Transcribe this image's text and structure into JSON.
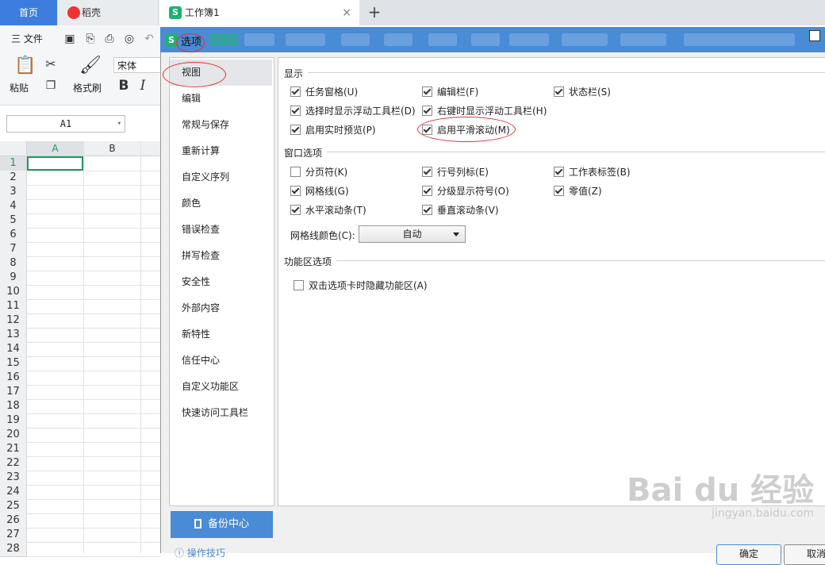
{
  "tabs": {
    "home": "首页",
    "daoke": "稻壳",
    "workbook": "工作簿1",
    "workbook_logo": "S",
    "close": "×",
    "add": "+"
  },
  "toolbar": {
    "file_menu": "三 文件",
    "paste_label": "粘贴",
    "format_painter_label": "格式刷",
    "font_name": "宋体",
    "bold": "B",
    "italic": "I"
  },
  "namebox": {
    "value": "A1"
  },
  "sheet": {
    "columns": [
      "A",
      "B"
    ],
    "rows": [
      "1",
      "2",
      "3",
      "4",
      "5",
      "6",
      "7",
      "8",
      "9",
      "10",
      "11",
      "12",
      "13",
      "14",
      "15",
      "16",
      "17",
      "18",
      "19",
      "20",
      "21",
      "22",
      "23",
      "24",
      "25",
      "26",
      "27",
      "28"
    ]
  },
  "dialog": {
    "title": "选项",
    "logo": "S",
    "nav": [
      "视图",
      "编辑",
      "常规与保存",
      "重新计算",
      "自定义序列",
      "颜色",
      "错误检查",
      "拼写检查",
      "安全性",
      "外部内容",
      "新特性",
      "信任中心",
      "自定义功能区",
      "快速访问工具栏"
    ],
    "active_nav": "视图",
    "display": {
      "title": "显示",
      "items": [
        {
          "label": "任务窗格(U)",
          "checked": true
        },
        {
          "label": "编辑栏(F)",
          "checked": true
        },
        {
          "label": "状态栏(S)",
          "checked": true
        },
        {
          "label": "选择时显示浮动工具栏(D)",
          "checked": true
        },
        {
          "label": "右键时显示浮动工具栏(H)",
          "checked": true
        },
        {
          "label": "启用实时预览(P)",
          "checked": true
        },
        {
          "label": "启用平滑滚动(M)",
          "checked": true
        }
      ]
    },
    "window": {
      "title": "窗口选项",
      "items": [
        {
          "label": "分页符(K)",
          "checked": false
        },
        {
          "label": "行号列标(E)",
          "checked": true
        },
        {
          "label": "工作表标签(B)",
          "checked": true
        },
        {
          "label": "网格线(G)",
          "checked": true
        },
        {
          "label": "分级显示符号(O)",
          "checked": true
        },
        {
          "label": "零值(Z)",
          "checked": true
        },
        {
          "label": "水平滚动条(T)",
          "checked": true
        },
        {
          "label": "垂直滚动条(V)",
          "checked": true
        }
      ],
      "grid_color_label": "网格线颜色(C):",
      "grid_color_value": "自动"
    },
    "ribbon": {
      "title": "功能区选项",
      "items": [
        {
          "label": "双击选项卡时隐藏功能区(A)",
          "checked": false
        }
      ]
    },
    "backup_button": "备份中心",
    "tips": "操作技巧",
    "ok_button": "确定",
    "cancel_button": "取消"
  },
  "watermark": {
    "main": "Bai du 经验",
    "sub": "jingyan.baidu.com"
  },
  "colors": {
    "accent": "#4a8bd6",
    "home_tab": "#3d7ddd",
    "selection": "#1e9b5b",
    "annotation": "#dd3333"
  }
}
